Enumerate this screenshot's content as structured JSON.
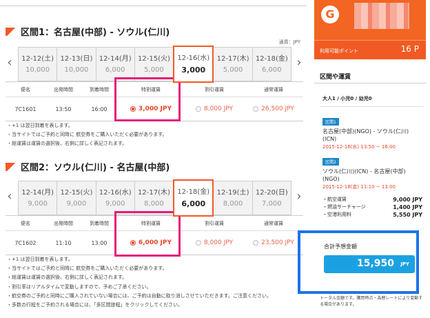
{
  "section1": {
    "title": "区間1：名古屋(中部) - ソウル(仁川)",
    "currency_note": "通貨：JPY",
    "dates": [
      {
        "date": "12-12(土)",
        "price": "10,000"
      },
      {
        "date": "12-13(日)",
        "price": "10,000"
      },
      {
        "date": "12-14(月)",
        "price": "6,000"
      },
      {
        "date": "12-15(火)",
        "price": "5,000"
      },
      {
        "date": "12-16(水)",
        "price": "3,000"
      },
      {
        "date": "12-17(木)",
        "price": "5,000"
      },
      {
        "date": "12-18(金)",
        "price": "6,000"
      }
    ],
    "selected_date_index": 4,
    "headers": [
      "便名",
      "出発時間",
      "到着時間",
      "特割運賃",
      "割引運賃",
      "通常運賃"
    ],
    "flight": {
      "no": "7C1601",
      "dep": "13:50",
      "arr": "16:00",
      "special": "3,000 JPY",
      "discount": "8,000 JPY",
      "normal": "26,500 JPY"
    }
  },
  "section2": {
    "title": "区間2：ソウル(仁川) - 名古屋(中部)",
    "dates": [
      {
        "date": "12-14(月)",
        "price": "9,000"
      },
      {
        "date": "12-15(火)",
        "price": "9,000"
      },
      {
        "date": "12-16(水)",
        "price": "9,000"
      },
      {
        "date": "12-17(木)",
        "price": "8,000"
      },
      {
        "date": "12-18(金)",
        "price": "6,000"
      },
      {
        "date": "12-19(土)",
        "price": "8,000"
      },
      {
        "date": "12-20(日)",
        "price": "7,000"
      }
    ],
    "selected_date_index": 4,
    "headers": [
      "便名",
      "出発時間",
      "到着時間",
      "特割運賃",
      "割引運賃",
      "通常運賃"
    ],
    "flight": {
      "no": "7C1602",
      "dep": "11:10",
      "arr": "13:00",
      "special": "6,000 JPY",
      "discount": "8,000 JPY",
      "normal": "23,500 JPY"
    }
  },
  "notes1": [
    "・+1 は翌日到着を表します。",
    "・当サイトではご予約と同時に 航空券をご購入いただく必要があります。",
    "・総運賃は運賃の選択後、右側に詳しく表記されます。"
  ],
  "notes2": [
    "・+1 は翌日到着を表します。",
    "・当サイトではご予約と同時に 航空券をご購入いただく必要があります。",
    "・総運賃は運賃の選択後、右側に詳しく表記されます。"
  ],
  "footer_notes": [
    "・割引率はリアルタイムで変動しますので、予めご了承ください。",
    "・航空券のご予約と同時にご購入されていない場合には、ご予約は自動に取り消しさせていただきます。ご注意ください。",
    "・多数の行程をご予約される場合には、「多区間旅程」をクリックしてください。"
  ],
  "sidebar": {
    "logo_letter": "G",
    "points_label": "利用可能ポイント",
    "points_value": "16 P",
    "fare_heading": "区間や運賃",
    "pax": "大人1 / 小児0 / 幼児0",
    "segments": [
      {
        "tag": "区間1",
        "route": "名古屋(中部)(NGO) - ソウル(仁川)(ICN)",
        "datetime": "2015-12-16(水) 13:50 ~ 16:00"
      },
      {
        "tag": "区間2",
        "route": "ソウル(仁川)(ICN) - 名古屋(中部)(NGO)",
        "datetime": "2015-12-18(金) 11:10 ~ 13:00"
      }
    ],
    "fares": [
      {
        "label": "・航空運賃",
        "value": "9,000 JPY"
      },
      {
        "label": "・燃油サーチャージ",
        "value": "1,400 JPY"
      },
      {
        "label": "・空港利用料",
        "value": "5,550 JPY"
      }
    ],
    "total_label": "合計予想金額",
    "total_value": "15,950",
    "total_currency": "JPY",
    "bottom_note": "トータル金額です。購買時点・為替レートにより変動する場合があります。"
  },
  "colors": {
    "accent": "#f26522",
    "highlight_pink": "#e6197b",
    "highlight_blue": "#1e73e8",
    "total_pill": "#1ba1e2"
  }
}
